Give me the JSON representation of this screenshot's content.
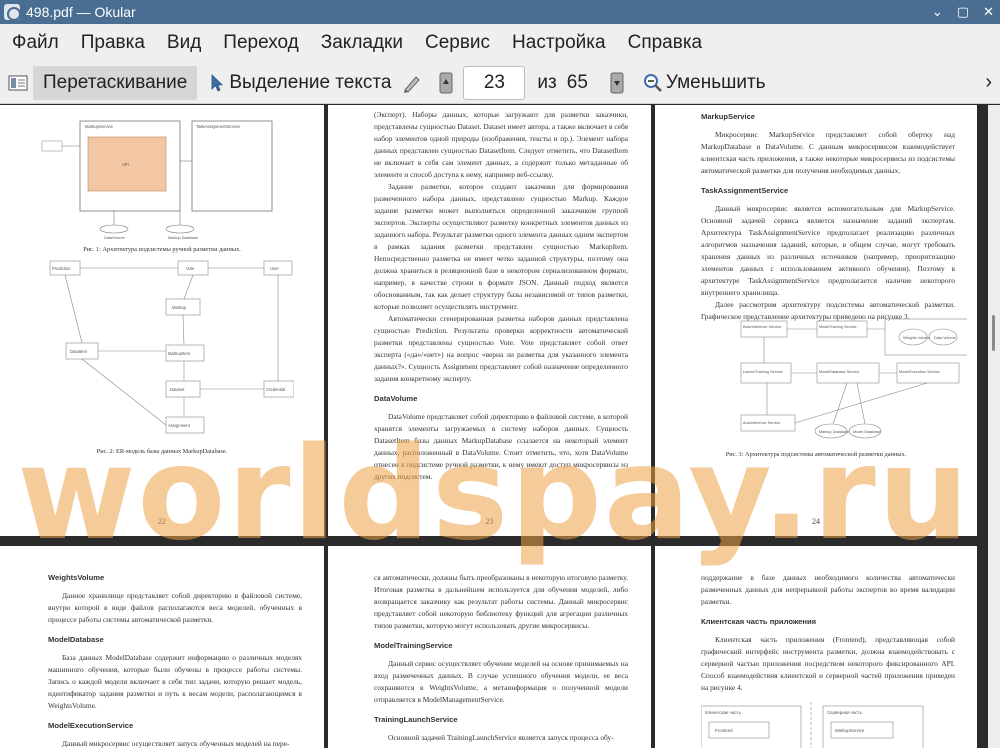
{
  "window": {
    "title": "498.pdf — Okular",
    "minimize_glyph": "⌄",
    "maximize_glyph": "▢",
    "close_glyph": "✕"
  },
  "menu": [
    "Файл",
    "Правка",
    "Вид",
    "Переход",
    "Закладки",
    "Сервис",
    "Настройка",
    "Справка"
  ],
  "toolbar": {
    "browse": "Перетаскивание",
    "select_text": "Выделение текста",
    "page": "23",
    "of_label": "из",
    "total": "65",
    "zoom_out": "Уменьшить",
    "more": "›"
  },
  "watermark": "worldspay.ru",
  "pages": {
    "p22": {
      "fig1_caption": "Рис. 1:  Архитектура подсистемы ручной разметки данных.",
      "fig1_labels": [
        "MarkupService",
        "TaskAssignmentService",
        "API",
        "DataVolume",
        "Markup Database"
      ],
      "fig2_labels": [
        "Prediction",
        "Vote",
        "User",
        "Markup",
        "MarkupItem",
        "DataItem",
        "Dataset",
        "Credential",
        "Assignment"
      ],
      "fig2_caption": "Рис. 2:  ER-модель базы данных MarkupDatabase.",
      "num": "22"
    },
    "p23": {
      "paras": [
        "(Эксперт). Наборы данных, которые загружают для разметки заказчики, представлены сущностью Dataset. Dataset имеет автора, а также включает в себя набор элементов одной природы (изображения, тексты и пр.). Элемент набора данных представлен сущностью DatasetItem. Следует отметить, что DatasetItem не включает в себя сам элемент данных, а содержит только метаданные об элементе и способ доступа к нему, например веб-ссылку.",
        "Задание разметки, которое создают заказчики для формирования размеченного набора данных, представлено сущностью Markup. Каждое задание разметки может выполняться определенной заказчиком группой экспертов. Эксперты осуществляют разметку конкретных элементов данных из заданного набора. Результат разметки одного элемента данных одним экспертом в рамках задания разметки представлен сущностью MarkupItem. Непосредственно разметка не имеет четко заданной структуры, поэтому она должна храниться в реляционной базе в некотором сериализованном формате, например, в качестве строки в формате JSON. Данный подход является обоснованным, так как делает структуру базы независимой от типов разметки, которые позволяет осуществлять инструмент.",
        "Автоматически сгенерированная разметка наборов данных представлена сущностью Prediction. Результаты проверки корректности автоматической разметки представлены сущностью Vote. Vote представляет собой ответ эксперта («да»/«нет») на вопрос «верна ли разметка для указанного элемента данных?». Сущность Assignment представляет собой назначение определенного задания конкретному эксперту."
      ],
      "h": "DataVolume",
      "paras2": [
        "DataVolume представляет собой директорию в файловой системе, в которой хранятся элементы загружаемых в систему наборов данных. Сущность DatasetItem базы данных MarkupDatabase ссылается на некоторый элемент данных, расположенный в DataVolume. Стоит отметить, что, хотя DataVolume отнесен к подсистеме ручной разметки, к нему имеют доступ микросервисы из других подсистем."
      ],
      "num": "23"
    },
    "p24": {
      "h1": "MarkupService",
      "t1": "Микросервис MarkupService представляет собой обертку над MarkupDatabase и DataVolume. С данным микросервисом взаимодействует клиентская часть приложения, а также некоторые микросервисы из подсистемы автоматической разметки для получения необходимых данных.",
      "h2": "TaskAssignmentService",
      "t2": "Данный микросервис является вспомогательным для MarkupService. Основной задачей сервиса является назначение заданий экспертам. Архитектура TaskAssignmentService предполагает реализацию различных алгоритмов назначения заданий, которые, в общем случае, могут требовать хранения данных из различных источников (например, приоритизацию элементов данных с использованием активного обучения). Поэтому в архитектуре TaskAssignmentService предполагается наличие некоторого внутреннего хранилища.",
      "t3": "Далее рассмотрим архитектуру подсистемы автоматической разметки. Графическое представление архитектуры приведено на рисунке 3.",
      "fig_labels": [
        "BaseInference Service",
        "ModelTraining Service",
        "Weights Volume",
        "Data Volume",
        "LaunchTraining Service",
        "ModelDatabase Service",
        "ModelExecution Service",
        "Markup Database",
        "Model Database",
        "AutoInference Service"
      ],
      "caption": "Рис. 3:  Архитектура подсистемы автоматической разметки данных.",
      "num": "24"
    },
    "p25": {
      "h1": "WeightsVolume",
      "t1": "Данное хранилище представляет собой директорию в файловой системе, внутри которой в виде файлов располагаются веса моделей, обученных в процессе работы системы автоматической разметки.",
      "h2": "ModelDatabase",
      "t2": "База данных ModelDatabase содержит информацию о различных моделях машинного обучения, которые были обучены в процессе работы системы. Запись о каждой модели включает в себя тип задачи, которую решает модель, идентификатор задания разметки и путь к весам модели, располагающимся в WeightsVolume.",
      "h3": "ModelExecutionService",
      "t3": "Данный микросервис осуществляет запуск обученных моделей на пере-"
    },
    "p26": {
      "t1": "ся автоматически, должны быть преобразованы в некоторую итоговую разметку. Итоговая разметка в дальнейшем используется для обучения моделей, либо возвращается заказчику как результат работы системы. Данный микросервис представляет собой некоторую библиотеку функций для агрегации различных типов разметки, которую могут использовать другие микросервисы.",
      "h1": "ModelTrainingService",
      "t2": "Данный сервис осуществляет обучение моделей на основе принимаемых на вход размеченных данных. В случае успешного обучения модели, ее веса сохраняются в WeightsVolume, а метаинформация о полученной модели отправляется в ModelManagementService.",
      "h2": "TrainingLaunchService",
      "t3": "Основной задачей TrainingLaunchService является запуск процесса обу-"
    },
    "p27": {
      "t1": "поддержание в базе данных необходимого количества автоматически размеченных данных для непрерывной работы экспертов во время валидации разметки.",
      "h1": "Клиентская часть приложения",
      "t2": "Клиентская часть приложения (Frontend), представляющая собой графический интерфейс инструмента разметки, должна взаимодействовать с серверной частью приложения посредством некоторого фиксированного API. Способ взаимодействия клиентской и серверной частей приложения приведен на рисунке 4.",
      "lbl_client": "Клиентская часть",
      "lbl_server": "Серверная часть",
      "lbl_frontend": "Frontend",
      "lbl_markup": "MarkupService"
    }
  }
}
